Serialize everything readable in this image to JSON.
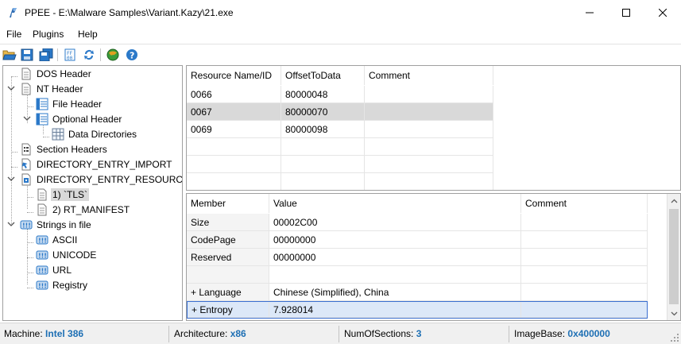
{
  "window": {
    "title": "PPEE - E:\\Malware Samples\\Variant.Kazy\\21.exe"
  },
  "menu": [
    "File",
    "Plugins",
    "Help"
  ],
  "toolbar": {
    "buttons": [
      "open-icon",
      "save-icon",
      "save-all-icon",
      "hex-view-icon",
      "refresh-icon",
      "virustotal-icon",
      "help-icon"
    ]
  },
  "tree": {
    "nodes": [
      {
        "label": "DOS Header"
      },
      {
        "label": "NT Header"
      },
      {
        "label": "File Header"
      },
      {
        "label": "Optional Header"
      },
      {
        "label": "Data Directories"
      },
      {
        "label": "Section Headers"
      },
      {
        "label": "DIRECTORY_ENTRY_IMPORT"
      },
      {
        "label": "DIRECTORY_ENTRY_RESOURCE"
      },
      {
        "label": "1) `TLS`"
      },
      {
        "label": "2) RT_MANIFEST"
      },
      {
        "label": "Strings in file"
      },
      {
        "label": "ASCII"
      },
      {
        "label": "UNICODE"
      },
      {
        "label": "URL"
      },
      {
        "label": "Registry"
      }
    ]
  },
  "resource_grid": {
    "headers": [
      "Resource Name/ID",
      "OffsetToData",
      "Comment"
    ],
    "rows": [
      [
        "0066",
        "80000048",
        ""
      ],
      [
        "0067",
        "80000070",
        ""
      ],
      [
        "0069",
        "80000098",
        ""
      ]
    ]
  },
  "member_grid": {
    "headers": [
      "Member",
      "Value",
      "Comment"
    ],
    "rows": [
      [
        "Size",
        "00002C00",
        ""
      ],
      [
        "CodePage",
        "00000000",
        ""
      ],
      [
        "Reserved",
        "00000000",
        ""
      ],
      [
        "",
        "",
        ""
      ],
      [
        "+ Language",
        "Chinese (Simplified), China",
        ""
      ],
      [
        "+ Entropy",
        "7.928014",
        ""
      ]
    ]
  },
  "status": {
    "machine_label": "Machine:",
    "machine_value": "Intel 386",
    "arch_label": "Architecture:",
    "arch_value": "x86",
    "sections_label": "NumOfSections:",
    "sections_value": "3",
    "imagebase_label": "ImageBase:",
    "imagebase_value": "0x400000"
  },
  "colors": {
    "accent": "#1d6fb4",
    "selection": "#d9d9d9",
    "focus_border": "#3a6fd0"
  }
}
